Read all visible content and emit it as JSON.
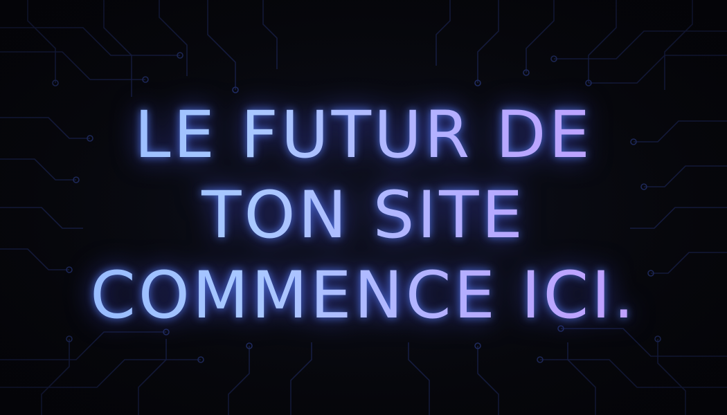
{
  "headline": {
    "lines": [
      "LE FUTUR DE",
      "TON SITE",
      "COMMENCE ICI."
    ]
  },
  "colors": {
    "background": "#07080d",
    "circuit": "#1b2350",
    "text_start": "#8fb6ff",
    "text_end": "#c79bff",
    "glow": "#5a82ff"
  },
  "icons": [
    "circuit-board-pattern"
  ]
}
